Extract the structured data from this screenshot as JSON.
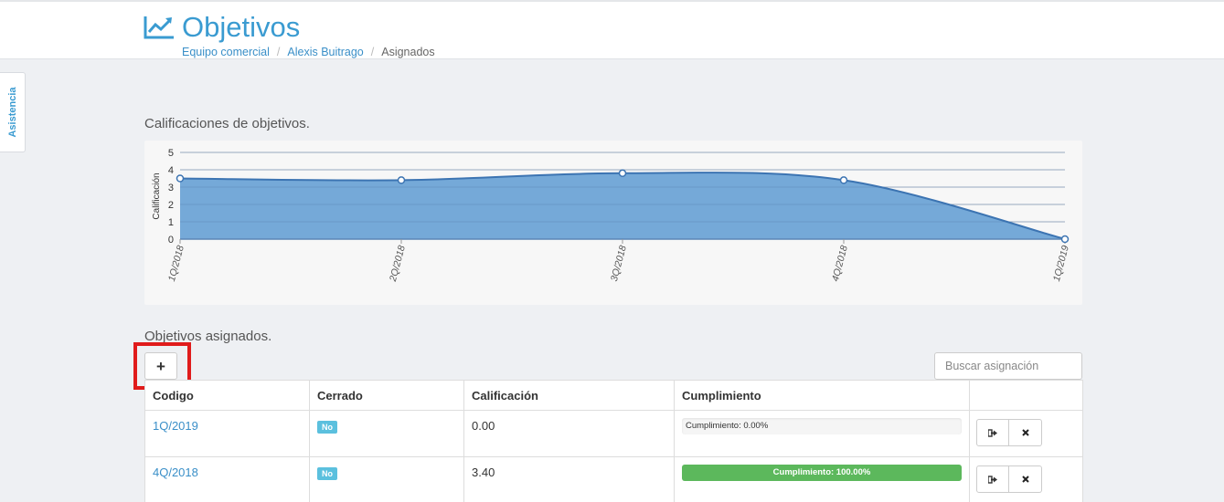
{
  "header": {
    "title": "Objetivos",
    "title_icon": "chart-line-icon",
    "breadcrumb": [
      {
        "label": "Equipo comercial"
      },
      {
        "label": "Alexis Buitrago"
      },
      {
        "label": "Asignados"
      }
    ]
  },
  "side_tab": {
    "label": "Asistencia"
  },
  "chart_section": {
    "title": "Calificaciones de objetivos."
  },
  "chart_data": {
    "type": "area",
    "title": "",
    "xlabel": "",
    "ylabel": "Calificación",
    "ylim": [
      0,
      5
    ],
    "y_ticks": [
      "0",
      "1",
      "2",
      "3",
      "4",
      "5"
    ],
    "categories": [
      "1Q/2018",
      "2Q/2018",
      "3Q/2018",
      "4Q/2018",
      "1Q/2019"
    ],
    "values": [
      3.5,
      3.4,
      3.8,
      3.4,
      0.0
    ],
    "grid": true,
    "colors": {
      "fill": "#75a9d8",
      "line": "#3c74b2",
      "point": "#ffffff"
    }
  },
  "assignments": {
    "title": "Objetivos asignados.",
    "add_label": "+",
    "search_placeholder": "Buscar asignación",
    "columns": [
      "Codigo",
      "Cerrado",
      "Calificación",
      "Cumplimiento",
      ""
    ],
    "rows": [
      {
        "codigo": "1Q/2019",
        "cerrado": "No",
        "calificacion": "0.00",
        "cumplimiento": "Cumplimiento: 0.00%",
        "progress": 0
      },
      {
        "codigo": "4Q/2018",
        "cerrado": "No",
        "calificacion": "3.40",
        "cumplimiento": "Cumplimiento: 100.00%",
        "progress": 100
      }
    ],
    "action_icons": [
      "sign-out-icon",
      "close-icon"
    ]
  }
}
